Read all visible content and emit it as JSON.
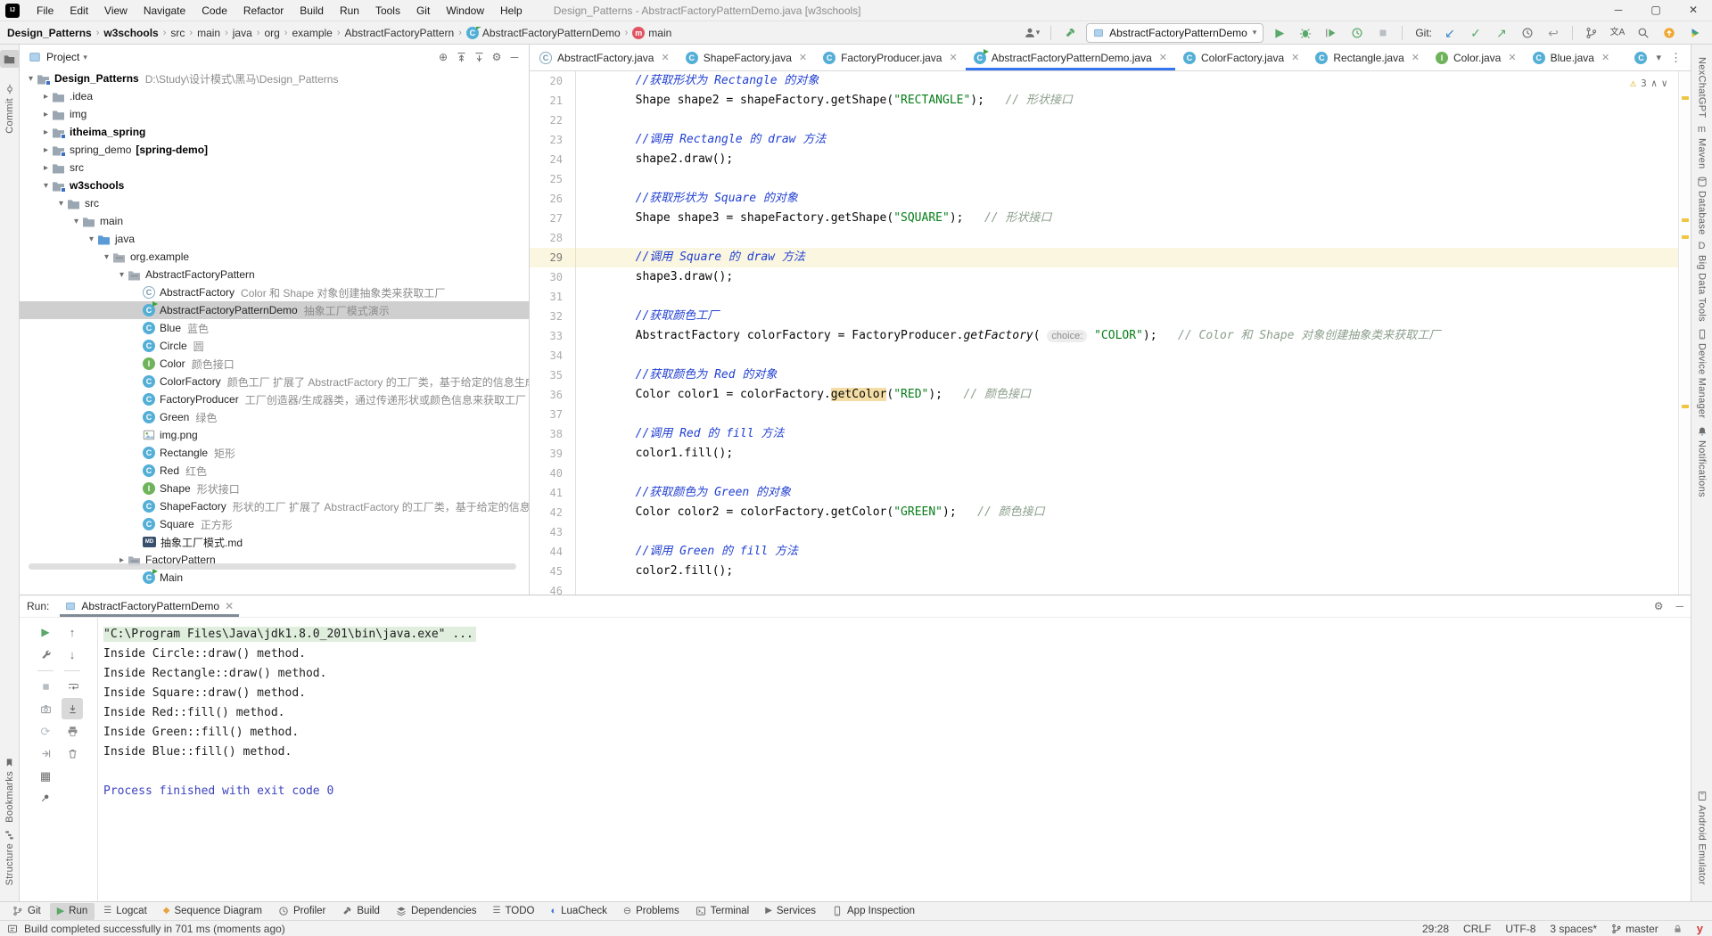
{
  "window": {
    "title": "Design_Patterns - AbstractFactoryPatternDemo.java [w3schools]",
    "logo": "IJ"
  },
  "menus": [
    "File",
    "Edit",
    "View",
    "Navigate",
    "Code",
    "Refactor",
    "Build",
    "Run",
    "Tools",
    "Git",
    "Window",
    "Help"
  ],
  "breadcrumbs": [
    {
      "label": "Design_Patterns",
      "bold": true
    },
    {
      "label": "w3schools",
      "bold": true
    },
    {
      "label": "src"
    },
    {
      "label": "main"
    },
    {
      "label": "java"
    },
    {
      "label": "org"
    },
    {
      "label": "example"
    },
    {
      "label": "AbstractFactoryPattern"
    },
    {
      "label": "AbstractFactoryPatternDemo",
      "icon": "class-run"
    },
    {
      "label": "main",
      "icon": "method"
    }
  ],
  "toolbar": {
    "run_config": "AbstractFactoryPatternDemo",
    "git_label": "Git:"
  },
  "tabs": [
    {
      "label": "AbstractFactory.java",
      "icon": "class-abstract"
    },
    {
      "label": "ShapeFactory.java",
      "icon": "class"
    },
    {
      "label": "FactoryProducer.java",
      "icon": "class"
    },
    {
      "label": "AbstractFactoryPatternDemo.java",
      "icon": "class-run",
      "active": true
    },
    {
      "label": "ColorFactory.java",
      "icon": "class"
    },
    {
      "label": "Rectangle.java",
      "icon": "class"
    },
    {
      "label": "Color.java",
      "icon": "interface"
    },
    {
      "label": "Blue.java",
      "icon": "class"
    }
  ],
  "project": {
    "header": "Project",
    "tree": [
      {
        "lvl": 0,
        "chev": "open",
        "icon": "module",
        "name": "Design_Patterns",
        "bold": true,
        "desc": "D:\\Study\\设计模式\\黑马\\Design_Patterns"
      },
      {
        "lvl": 1,
        "chev": "closed",
        "icon": "folder",
        "name": ".idea"
      },
      {
        "lvl": 1,
        "chev": "closed",
        "icon": "folder",
        "name": "img"
      },
      {
        "lvl": 1,
        "chev": "closed",
        "icon": "module",
        "name": "itheima_spring",
        "bold": true
      },
      {
        "lvl": 1,
        "chev": "closed",
        "icon": "module",
        "name": "spring_demo",
        "suffix": "[spring-demo]"
      },
      {
        "lvl": 1,
        "chev": "closed",
        "icon": "folder",
        "name": "src"
      },
      {
        "lvl": 1,
        "chev": "open",
        "icon": "module",
        "name": "w3schools",
        "bold": true
      },
      {
        "lvl": 2,
        "chev": "open",
        "icon": "folder",
        "name": "src"
      },
      {
        "lvl": 3,
        "chev": "open",
        "icon": "folder",
        "name": "main"
      },
      {
        "lvl": 4,
        "chev": "open",
        "icon": "folder-src",
        "name": "java"
      },
      {
        "lvl": 5,
        "chev": "open",
        "icon": "package",
        "name": "org.example"
      },
      {
        "lvl": 6,
        "chev": "open",
        "icon": "package",
        "name": "AbstractFactoryPattern"
      },
      {
        "lvl": 7,
        "icon": "class-abstract",
        "name": "AbstractFactory",
        "desc": "Color 和 Shape 对象创建抽象类来获取工厂"
      },
      {
        "lvl": 7,
        "icon": "class-run",
        "name": "AbstractFactoryPatternDemo",
        "desc": "抽象工厂模式演示",
        "selected": true
      },
      {
        "lvl": 7,
        "icon": "class",
        "name": "Blue",
        "desc": "蓝色"
      },
      {
        "lvl": 7,
        "icon": "class",
        "name": "Circle",
        "desc": "圆"
      },
      {
        "lvl": 7,
        "icon": "interface",
        "name": "Color",
        "desc": "颜色接口"
      },
      {
        "lvl": 7,
        "icon": "class",
        "name": "ColorFactory",
        "desc": "颜色工厂 扩展了 AbstractFactory 的工厂类，基于给定的信息生成实体类的"
      },
      {
        "lvl": 7,
        "icon": "class",
        "name": "FactoryProducer",
        "desc": "工厂创造器/生成器类，通过传递形状或颜色信息来获取工厂"
      },
      {
        "lvl": 7,
        "icon": "class",
        "name": "Green",
        "desc": "绿色"
      },
      {
        "lvl": 7,
        "icon": "image",
        "name": "img.png"
      },
      {
        "lvl": 7,
        "icon": "class",
        "name": "Rectangle",
        "desc": "矩形"
      },
      {
        "lvl": 7,
        "icon": "class",
        "name": "Red",
        "desc": "红色"
      },
      {
        "lvl": 7,
        "icon": "interface",
        "name": "Shape",
        "desc": "形状接口"
      },
      {
        "lvl": 7,
        "icon": "class",
        "name": "ShapeFactory",
        "desc": "形状的工厂 扩展了 AbstractFactory 的工厂类，基于给定的信息生成实体类"
      },
      {
        "lvl": 7,
        "icon": "class",
        "name": "Square",
        "desc": "正方形"
      },
      {
        "lvl": 7,
        "icon": "md",
        "name": "抽象工厂模式.md"
      },
      {
        "lvl": 6,
        "chev": "closed",
        "icon": "package",
        "name": "FactoryPattern"
      },
      {
        "lvl": 7,
        "icon": "class-run",
        "name": "Main"
      }
    ]
  },
  "editor": {
    "inspections_count": "3",
    "lines": [
      {
        "n": 20,
        "segs": [
          {
            "t": "        //获取形状为 Rectangle 的对象",
            "c": "cmt"
          }
        ]
      },
      {
        "n": 21,
        "segs": [
          {
            "t": "        Shape shape2 = shapeFactory.getShape(",
            "c": "code"
          },
          {
            "t": "\"RECTANGLE\"",
            "c": "str"
          },
          {
            "t": ");   ",
            "c": "code"
          },
          {
            "t": "// 形状接口",
            "c": "tcmt"
          }
        ]
      },
      {
        "n": 22,
        "segs": []
      },
      {
        "n": 23,
        "segs": [
          {
            "t": "        //调用 Rectangle 的 draw 方法",
            "c": "cmt"
          }
        ]
      },
      {
        "n": 24,
        "segs": [
          {
            "t": "        shape2.draw();",
            "c": "code"
          }
        ]
      },
      {
        "n": 25,
        "segs": []
      },
      {
        "n": 26,
        "segs": [
          {
            "t": "        //获取形状为 Square 的对象",
            "c": "cmt"
          }
        ]
      },
      {
        "n": 27,
        "segs": [
          {
            "t": "        Shape shape3 = shapeFactory.getShape(",
            "c": "code"
          },
          {
            "t": "\"SQUARE\"",
            "c": "str"
          },
          {
            "t": ");   ",
            "c": "code"
          },
          {
            "t": "// 形状接口",
            "c": "tcmt"
          }
        ]
      },
      {
        "n": 28,
        "segs": []
      },
      {
        "n": 29,
        "caret": true,
        "segs": [
          {
            "t": "        //调用 Square 的 draw 方法",
            "c": "cmt"
          }
        ]
      },
      {
        "n": 30,
        "segs": [
          {
            "t": "        shape3.draw();",
            "c": "code"
          }
        ]
      },
      {
        "n": 31,
        "segs": []
      },
      {
        "n": 32,
        "segs": [
          {
            "t": "        //获取颜色工厂",
            "c": "cmt"
          }
        ]
      },
      {
        "n": 33,
        "segs": [
          {
            "t": "        AbstractFactory colorFactory = FactoryProducer.",
            "c": "code"
          },
          {
            "t": "getFactory",
            "c": "it"
          },
          {
            "t": "( ",
            "c": "code"
          },
          {
            "t": "choice:",
            "c": "hint"
          },
          {
            "t": " ",
            "c": "code"
          },
          {
            "t": "\"COLOR\"",
            "c": "str"
          },
          {
            "t": ");   ",
            "c": "code"
          },
          {
            "t": "// Color 和 Shape 对象创建抽象类来获取工厂",
            "c": "tcmt"
          }
        ]
      },
      {
        "n": 34,
        "segs": []
      },
      {
        "n": 35,
        "segs": [
          {
            "t": "        //获取颜色为 Red 的对象",
            "c": "cmt"
          }
        ]
      },
      {
        "n": 36,
        "segs": [
          {
            "t": "        Color color1 = colorFactory.",
            "c": "code"
          },
          {
            "t": "getColor",
            "c": "hl"
          },
          {
            "t": "(",
            "c": "code"
          },
          {
            "t": "\"RED\"",
            "c": "str"
          },
          {
            "t": ");   ",
            "c": "code"
          },
          {
            "t": "// 颜色接口",
            "c": "tcmt"
          }
        ]
      },
      {
        "n": 37,
        "segs": []
      },
      {
        "n": 38,
        "segs": [
          {
            "t": "        //调用 Red 的 fill 方法",
            "c": "cmt"
          }
        ]
      },
      {
        "n": 39,
        "segs": [
          {
            "t": "        color1.fill();",
            "c": "code"
          }
        ]
      },
      {
        "n": 40,
        "segs": []
      },
      {
        "n": 41,
        "segs": [
          {
            "t": "        //获取颜色为 Green 的对象",
            "c": "cmt"
          }
        ]
      },
      {
        "n": 42,
        "segs": [
          {
            "t": "        Color color2 = colorFactory.",
            "c": "code"
          },
          {
            "t": "getColor",
            "c": "code"
          },
          {
            "t": "(",
            "c": "code"
          },
          {
            "t": "\"GREEN\"",
            "c": "str"
          },
          {
            "t": ");   ",
            "c": "code"
          },
          {
            "t": "// 颜色接口",
            "c": "tcmt"
          }
        ]
      },
      {
        "n": 43,
        "segs": []
      },
      {
        "n": 44,
        "segs": [
          {
            "t": "        //调用 Green 的 fill 方法",
            "c": "cmt"
          }
        ]
      },
      {
        "n": 45,
        "segs": [
          {
            "t": "        color2.fill();",
            "c": "code"
          }
        ]
      },
      {
        "n": 46,
        "segs": []
      }
    ]
  },
  "run_panel": {
    "label": "Run:",
    "tab": "AbstractFactoryPatternDemo",
    "console": [
      {
        "t": "\"C:\\Program Files\\Java\\jdk1.8.0_201\\bin\\java.exe\" ...",
        "c": "cmd"
      },
      {
        "t": "Inside Circle::draw() method."
      },
      {
        "t": "Inside Rectangle::draw() method."
      },
      {
        "t": "Inside Square::draw() method."
      },
      {
        "t": "Inside Red::fill() method."
      },
      {
        "t": "Inside Green::fill() method."
      },
      {
        "t": "Inside Blue::fill() method."
      },
      {
        "t": ""
      },
      {
        "t": "Process finished with exit code 0",
        "c": "exit"
      }
    ]
  },
  "bottom_bar": [
    {
      "label": "Git",
      "icon": "branch"
    },
    {
      "label": "Run",
      "icon": "play-green",
      "active": true
    },
    {
      "label": "Logcat",
      "icon": "lines"
    },
    {
      "label": "Sequence Diagram",
      "icon": "diamond-orange"
    },
    {
      "label": "Profiler",
      "icon": "clock"
    },
    {
      "label": "Build",
      "icon": "hammer"
    },
    {
      "label": "Dependencies",
      "icon": "stack"
    },
    {
      "label": "TODO",
      "icon": "lines"
    },
    {
      "label": "LuaCheck",
      "icon": "moon-blue"
    },
    {
      "label": "Problems",
      "icon": "problem"
    },
    {
      "label": "Terminal",
      "icon": "terminal"
    },
    {
      "label": "Services",
      "icon": "services"
    },
    {
      "label": "App Inspection",
      "icon": "phone"
    }
  ],
  "status_bar": {
    "message": "Build completed successfully in 701 ms (moments ago)",
    "position": "29:28",
    "line_ending": "CRLF",
    "encoding": "UTF-8",
    "indent": "3 spaces*",
    "branch": "master"
  },
  "left_strip": {
    "top": [
      "Project",
      "Commit"
    ],
    "bottom": [
      "Bookmarks",
      "Structure"
    ]
  },
  "right_strip": {
    "top": [
      "NexChatGPT",
      "Maven",
      "Database",
      "Big Data Tools",
      "Device Manager",
      "Notifications"
    ],
    "bottom": [
      "Android Emulator"
    ]
  },
  "colors": {
    "accent_blue": "#3574F0",
    "string_green": "#067D17",
    "comment_blue": "#2140D2",
    "run_green": "#59A869",
    "warning_yellow": "#EFC541",
    "caret_row": "#FBF6E0",
    "selection_gray": "#CFCFCF",
    "exit_blue": "#3D43BF",
    "console_cmd_bg": "#DFEEDD",
    "method_highlight": "#F5DEA6",
    "git_update_blue": "#3E86C8"
  }
}
